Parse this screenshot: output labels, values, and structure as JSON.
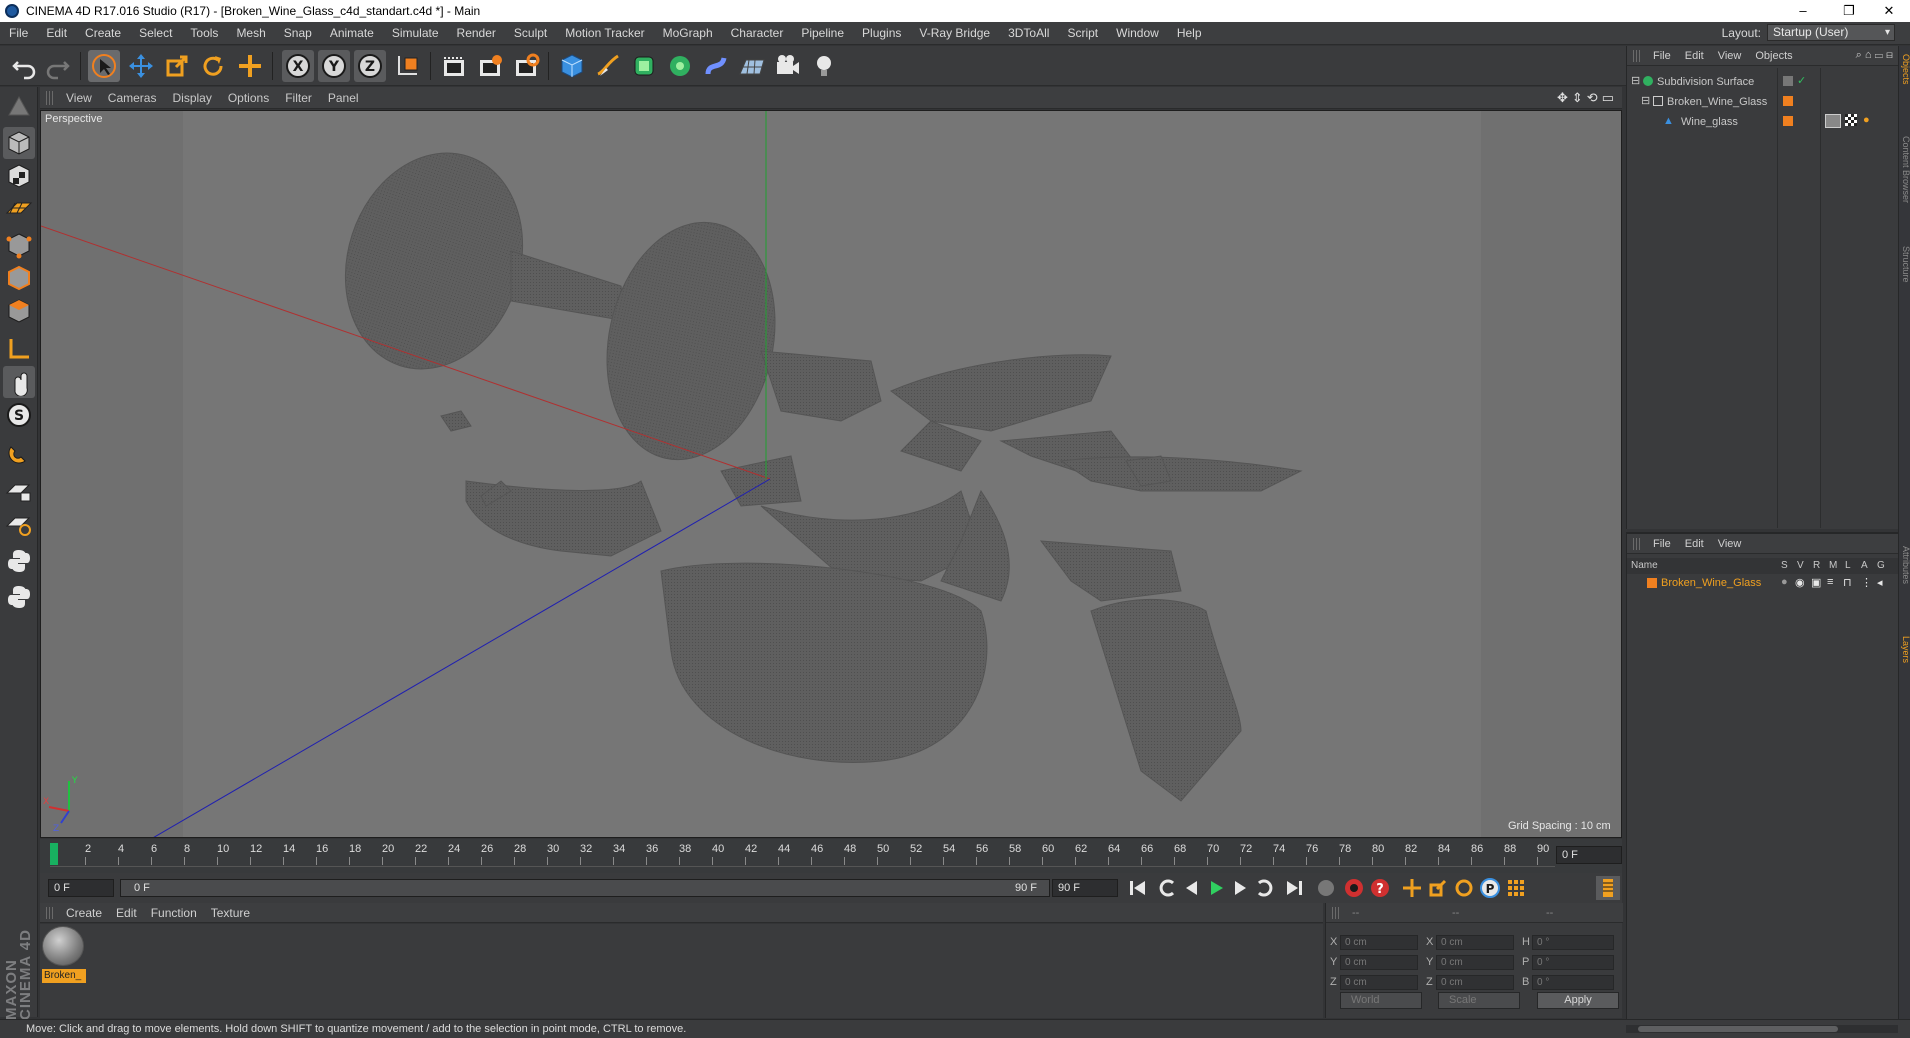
{
  "window": {
    "title": "CINEMA 4D R17.016 Studio (R17) - [Broken_Wine_Glass_c4d_standart.c4d *] - Main",
    "controls": [
      "‒",
      "❐",
      "✕"
    ]
  },
  "menubar": {
    "items": [
      "File",
      "Edit",
      "Create",
      "Select",
      "Tools",
      "Mesh",
      "Snap",
      "Animate",
      "Simulate",
      "Render",
      "Sculpt",
      "Motion Tracker",
      "MoGraph",
      "Character",
      "Pipeline",
      "Plugins",
      "V-Ray Bridge",
      "3DToAll",
      "Script",
      "Window",
      "Help"
    ],
    "layout_label": "Layout:",
    "layout_value": "Startup (User)"
  },
  "toolbar": {
    "icons": [
      "undo-icon",
      "redo-icon",
      "select-arrow-icon",
      "move-icon",
      "scale-icon",
      "rotate-icon",
      "move-plus-icon",
      "x-axis-icon",
      "y-axis-icon",
      "z-axis-icon",
      "world-coord-icon",
      "render-region-icon",
      "render-view-icon",
      "render-settings-icon",
      "cube-icon",
      "pen-icon",
      "subdivision-icon",
      "array-icon",
      "deformer-icon",
      "floor-icon",
      "camera-icon",
      "light-icon"
    ]
  },
  "viewport": {
    "menu": [
      "View",
      "Cameras",
      "Display",
      "Options",
      "Filter",
      "Panel"
    ],
    "camera_label": "Perspective",
    "grid_spacing": "Grid Spacing : 10 cm",
    "bg_color": "#767676"
  },
  "timeline": {
    "ticks": [
      "0",
      "2",
      "4",
      "6",
      "8",
      "10",
      "12",
      "14",
      "16",
      "18",
      "20",
      "22",
      "24",
      "26",
      "28",
      "30",
      "32",
      "34",
      "36",
      "38",
      "40",
      "42",
      "44",
      "46",
      "48",
      "50",
      "52",
      "54",
      "56",
      "58",
      "60",
      "62",
      "64",
      "66",
      "68",
      "70",
      "72",
      "74",
      "76",
      "78",
      "80",
      "82",
      "84",
      "86",
      "88",
      "90"
    ],
    "current_frame": "0 F",
    "start_field": "0 F",
    "range_start": "0 F",
    "range_end": "90 F",
    "end_field": "90 F"
  },
  "materials": {
    "menu": [
      "Create",
      "Edit",
      "Function",
      "Texture"
    ],
    "items": [
      {
        "name": "Broken_"
      }
    ]
  },
  "coordinates": {
    "header": [
      "--",
      "--",
      "--"
    ],
    "rows": [
      {
        "a": "X",
        "av": "0 cm",
        "b": "X",
        "bv": "0 cm",
        "c": "H",
        "cv": "0 °"
      },
      {
        "a": "Y",
        "av": "0 cm",
        "b": "Y",
        "bv": "0 cm",
        "c": "P",
        "cv": "0 °"
      },
      {
        "a": "Z",
        "av": "0 cm",
        "b": "Z",
        "bv": "0 cm",
        "c": "B",
        "cv": "0 °"
      }
    ],
    "mode": "World",
    "scale": "Scale",
    "apply": "Apply"
  },
  "objects": {
    "menu": [
      "File",
      "Edit",
      "View",
      "Objects"
    ],
    "items": [
      {
        "name": "Subdivision Surface",
        "level": 0
      },
      {
        "name": "Broken_Wine_Glass",
        "level": 1
      },
      {
        "name": "Wine_glass",
        "level": 2
      }
    ]
  },
  "attributes": {
    "menu": [
      "File",
      "Edit",
      "View"
    ],
    "columns": [
      "Name",
      "S",
      "V",
      "R",
      "M",
      "L",
      "A",
      "G"
    ],
    "items": [
      {
        "name": "Broken_Wine_Glass"
      }
    ],
    "highlight_color": "#f0a020"
  },
  "side_tabs": [
    "Objects",
    "Content Browser",
    "Structure",
    "Attributes",
    "Layers"
  ],
  "status": "Move: Click and drag to move elements. Hold down SHIFT to quantize movement / add to the selection in point mode, CTRL to remove.",
  "brand": "MAXON CINEMA 4D"
}
